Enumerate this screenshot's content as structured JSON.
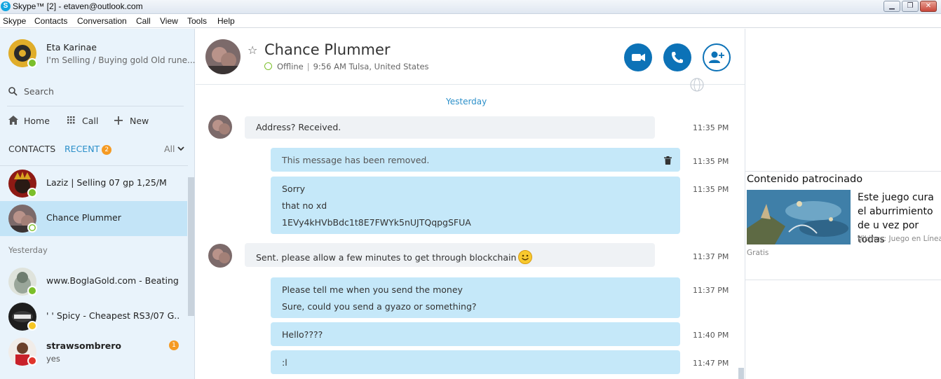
{
  "window": {
    "title": "Skype™ [2] - etaven@outlook.com",
    "app_icon_letter": "S",
    "minimize_glyph": "▁",
    "restore_glyph": "❐",
    "close_glyph": "✕"
  },
  "menu": [
    "Skype",
    "Contacts",
    "Conversation",
    "Call",
    "View",
    "Tools",
    "Help"
  ],
  "profile": {
    "name": "Eta Karinae",
    "mood": "I'm Selling / Buying gold Old rune...",
    "status": "online"
  },
  "search": {
    "label": "Search"
  },
  "nav": {
    "home": "Home",
    "call": "Call",
    "new": "New"
  },
  "tabs": {
    "contacts": "CONTACTS",
    "recent": "RECENT",
    "recent_badge": "2",
    "filter": "All"
  },
  "contacts": [
    {
      "name": "Laziz | Selling 07 gp 1,25/M",
      "status": "online"
    },
    {
      "name": "Chance Plummer",
      "status": "offline",
      "selected": true
    }
  ],
  "section_yesterday": "Yesterday",
  "recent": [
    {
      "name": "www.BoglaGold.com - Beating...",
      "status": "online"
    },
    {
      "name": "' ' Spicy - Cheapest RS3/07 G...",
      "status": "away"
    },
    {
      "name": "strawsombrero",
      "preview": "yes",
      "status": "busy",
      "badge": "1"
    }
  ],
  "chat_header": {
    "name": "Chance Plummer",
    "status": "Offline",
    "local_time": "9:56 AM Tulsa, United States"
  },
  "day_divider": "Yesterday",
  "messages": [
    {
      "dir": "in",
      "lines": [
        "Address? Received."
      ],
      "time": "11:35 PM"
    },
    {
      "dir": "out",
      "lines": [
        "This message has been removed."
      ],
      "time": "11:35 PM",
      "removed": true
    },
    {
      "dir": "out",
      "lines": [
        "Sorry",
        "that no xd",
        "1EVy4kHVbBdc1t8E7FWYk5nUJTQqpgSFUA"
      ],
      "time": "11:35 PM"
    },
    {
      "dir": "in",
      "lines": [
        "Sent. please allow a few minutes to get through blockchain"
      ],
      "time": "11:37 PM",
      "emoji": "smile"
    },
    {
      "dir": "out",
      "lines": [
        "Please tell me when you send the money",
        "Sure, could you send a gyazo or something?"
      ],
      "time": "11:37 PM"
    },
    {
      "dir": "out",
      "lines": [
        "Hello????"
      ],
      "time": "11:40 PM"
    },
    {
      "dir": "out",
      "lines": [
        ":l"
      ],
      "time": "11:47 PM"
    }
  ],
  "ad": {
    "heading": "Contenido patrocinado",
    "text": "Este juego cura el aburrimiento de u vez por todas",
    "source": "Vikings: Juego en Línea",
    "price": "Gratis"
  },
  "colors": {
    "accent": "#0c72b7",
    "sidebar_bg": "#e9f3fb",
    "selected_bg": "#c3e4f7",
    "outgoing_bubble": "#c5e8f9",
    "incoming_bubble": "#eff2f5",
    "online": "#7bbf2a",
    "away": "#f6c623",
    "busy": "#e0342b",
    "badge": "#f59a23"
  }
}
